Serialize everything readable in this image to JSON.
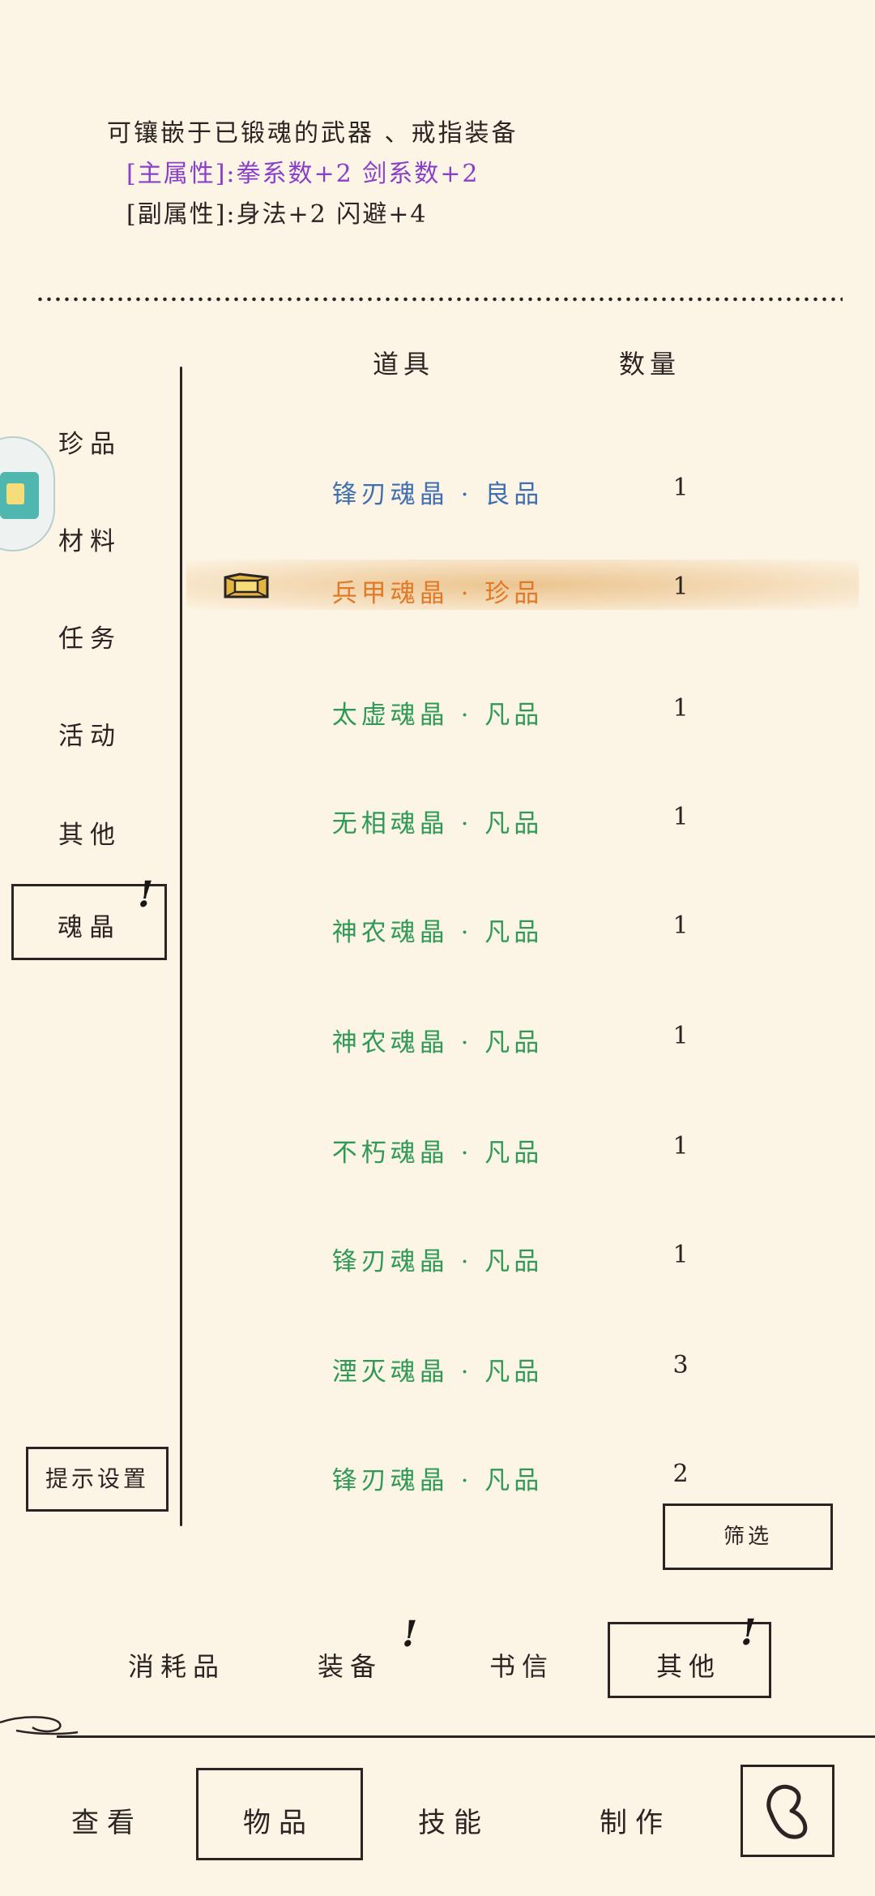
{
  "description": {
    "line1": "可镶嵌于已锻魂的武器 、戒指装备",
    "line2": "[主属性]:拳系数+2 剑系数+2",
    "line3": "[副属性]:身法+2 闪避+4"
  },
  "categories": [
    "珍品",
    "材料",
    "任务",
    "活动",
    "其他",
    "魂晶"
  ],
  "hint_settings_label": "提示设置",
  "table": {
    "header_item": "道具",
    "header_qty": "数量",
    "rows": [
      {
        "name": "锋刃魂晶 · 良品",
        "qty": "1",
        "color": "#3f6fb0"
      },
      {
        "name": "兵甲魂晶 · 珍品",
        "qty": "1",
        "color": "#e07a28"
      },
      {
        "name": "太虚魂晶 · 凡品",
        "qty": "1",
        "color": "#2f9a55"
      },
      {
        "name": "无相魂晶 · 凡品",
        "qty": "1",
        "color": "#2f9a55"
      },
      {
        "name": "神农魂晶 · 凡品",
        "qty": "1",
        "color": "#2f9a55"
      },
      {
        "name": "神农魂晶 · 凡品",
        "qty": "1",
        "color": "#2f9a55"
      },
      {
        "name": "不朽魂晶 · 凡品",
        "qty": "1",
        "color": "#2f9a55"
      },
      {
        "name": "锋刃魂晶 · 凡品",
        "qty": "1",
        "color": "#2f9a55"
      },
      {
        "name": "湮灭魂晶 · 凡品",
        "qty": "3",
        "color": "#2f9a55"
      },
      {
        "name": "锋刃魂晶 · 凡品",
        "qty": "2",
        "color": "#2f9a55"
      }
    ]
  },
  "filter_label": "筛选",
  "sub_tabs": [
    "消耗品",
    "装备",
    "书信",
    "其他"
  ],
  "bottom_nav": [
    "查看",
    "物品",
    "技能",
    "制作"
  ],
  "exclamation": "!",
  "colors": {
    "background": "#fcf4e4",
    "ink": "#2a2522",
    "primary_attr": "#8a3fc8"
  }
}
